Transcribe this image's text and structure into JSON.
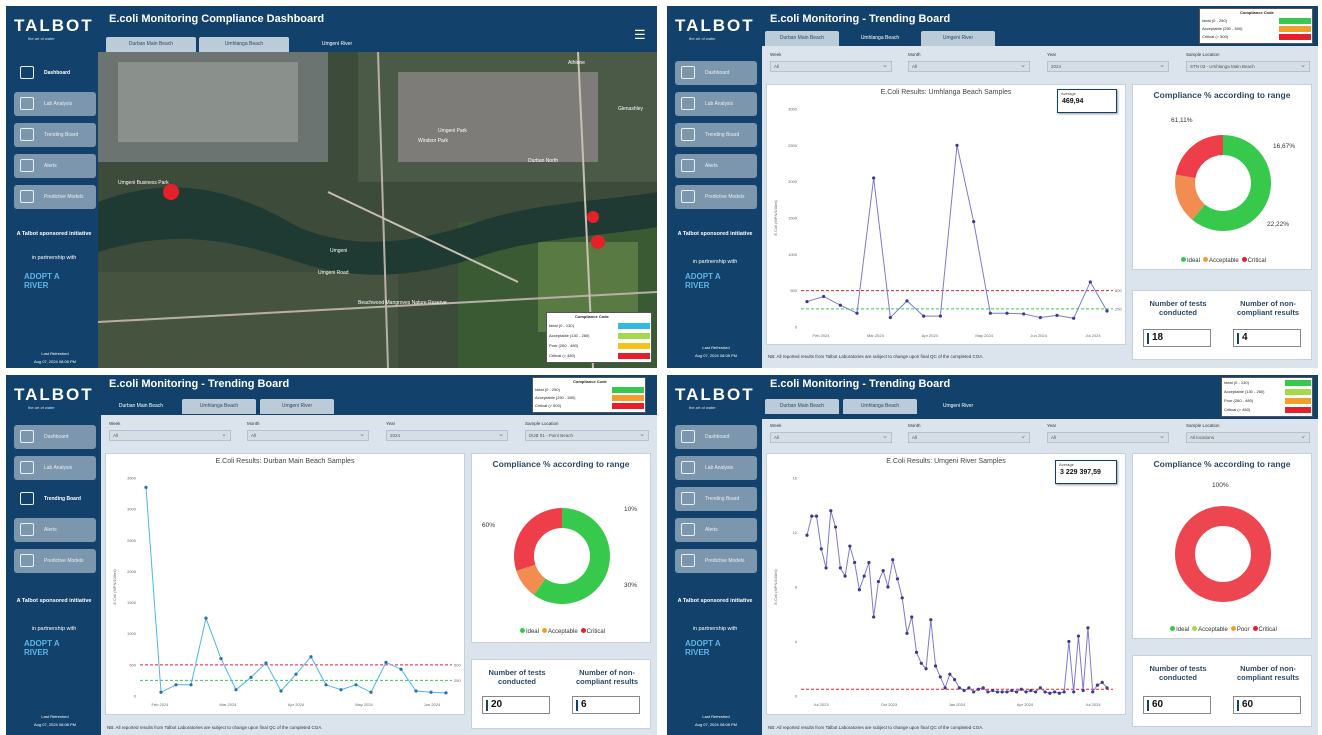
{
  "brand": {
    "logo": "TALBOT",
    "tagline": "the art of water"
  },
  "nav": {
    "dashboard": "Dashboard",
    "lab_analysis": "Lab Analysis",
    "trending_board": "Trending Board",
    "alerts": "Alerts",
    "predictive": "Predictive Models"
  },
  "sponsor": {
    "line1": "A Talbot sponsored initiative",
    "line2": "in partnership with",
    "partner": "ADOPT A RIVER"
  },
  "refresh": {
    "label": "Last Refreshed",
    "value": "Aug 07, 2024 08:08 PM"
  },
  "tabs": [
    "Durban Main Beach",
    "Umhlanga Beach",
    "Umgeni River"
  ],
  "compliance_code": {
    "title": "Compliance Code",
    "rows": [
      {
        "label": "Ideal (0 - 250)",
        "color": "#37c94b"
      },
      {
        "label": "Acceptable (250 - 500)",
        "color": "#f0a028"
      },
      {
        "label": "Critical (> 500)",
        "color": "#e5202a"
      }
    ],
    "map_rows": [
      {
        "label": "Ideal (0 - 130)",
        "color": "#32b9e6"
      },
      {
        "label": "Acceptable (130 - 260)",
        "color": "#a5d84a"
      },
      {
        "label": "Poor (260 - 480)",
        "color": "#f5c21c"
      },
      {
        "label": "Critical (> 480)",
        "color": "#e5202a"
      }
    ]
  },
  "filters": {
    "week": "Week",
    "month": "Month",
    "year": "Year",
    "location": "Sample Location",
    "all": "All",
    "year_val": "2024"
  },
  "p1": {
    "title": "E.coli Monitoring Compliance Dashboard",
    "map_labels": [
      "Umgeni Business Park",
      "Umgeni",
      "Umgeni Road",
      "Windsor Park",
      "Beachwood Mangroves Nature Reserve",
      "Athlone",
      "Durban North",
      "Umgeni Park",
      "Glenashley"
    ]
  },
  "p2": {
    "title": "E.coli Monitoring - Trending Board",
    "location": "STN 03 - Umhlanga Main Beach",
    "chart_title": "E.Coli Results: Umhlanga Beach Samples",
    "popup_label": "Average",
    "popup_value": "469,94",
    "donut_title": "Compliance % according to range",
    "pcts": [
      "61,11%",
      "16,67%",
      "22,22%"
    ],
    "kpi1_label": "Number of tests conducted",
    "kpi1": "18",
    "kpi2_label": "Number of non-compliant results",
    "kpi2": "4"
  },
  "p3": {
    "title": "E.coli Monitoring - Trending Board",
    "location": "DUB 01 - Point Beach",
    "chart_title": "E.Coli Results: Durban Main Beach Samples",
    "donut_title": "Compliance % according to range",
    "pcts": [
      "60%",
      "10%",
      "30%"
    ],
    "kpi1_label": "Number of tests conducted",
    "kpi1": "20",
    "kpi2_label": "Number of non-compliant results",
    "kpi2": "6"
  },
  "p4": {
    "title": "E.coli Monitoring - Trending Board",
    "location": "All locations",
    "chart_title": "E.Coli Results: Umgeni River Samples",
    "popup_label": "Average",
    "popup_value": "3 229 397,59",
    "donut_title": "Compliance % according to range",
    "pcts": [
      "100%"
    ],
    "kpi1_label": "Number of tests conducted",
    "kpi1": "60",
    "kpi2_label": "Number of non-compliant results",
    "kpi2": "60"
  },
  "legend_labels": {
    "ideal": "Ideal",
    "acceptable": "Acceptable",
    "poor": "Poor",
    "critical": "Critical"
  },
  "note": "NB: All reported results from Talbot Laboratories are subject to change upon final QC of the completed COA.",
  "chart_data": [
    {
      "type": "line",
      "title": "E.Coli Results: Umhlanga Beach Samples",
      "ylabel": "E.Coli (MPN/100ml)",
      "x_ticks": [
        "Feb 2024",
        "Mar 2024",
        "Apr 2024",
        "May 2024",
        "Jun 2024",
        "Jul 2024"
      ],
      "ylim": [
        0,
        3000
      ],
      "y_ticks": [
        0,
        500,
        1000,
        1500,
        2000,
        2500,
        3000
      ],
      "values": [
        350,
        420,
        300,
        190,
        2050,
        130,
        360,
        150,
        150,
        2500,
        1450,
        190,
        190,
        180,
        130,
        160,
        120,
        620,
        220
      ],
      "thresholds": [
        {
          "value": 500,
          "label": "500",
          "color": "#e5202a"
        },
        {
          "value": 250,
          "label": "250",
          "color": "#37c94b"
        }
      ]
    },
    {
      "type": "line",
      "title": "E.Coli Results: Durban Main Beach Samples",
      "ylabel": "E.Coli (MPN/100ml)",
      "x_ticks": [
        "Feb 2024",
        "Mar 2024",
        "Apr 2024",
        "May 2024",
        "Jun 2024"
      ],
      "ylim": [
        0,
        3500
      ],
      "y_ticks": [
        0,
        500,
        1000,
        1500,
        2000,
        2500,
        3000,
        3500
      ],
      "values": [
        3350,
        60,
        180,
        180,
        1250,
        600,
        100,
        300,
        530,
        80,
        350,
        630,
        180,
        100,
        180,
        60,
        540,
        430,
        80,
        60,
        50
      ],
      "thresholds": [
        {
          "value": 500,
          "label": "500",
          "color": "#e5202a"
        },
        {
          "value": 250,
          "label": "250",
          "color": "#37c94b"
        }
      ]
    },
    {
      "type": "line",
      "title": "E.Coli Results: Umgeni River Samples",
      "ylabel": "E.Coli (MPN/100ml)",
      "x_ticks": [
        "Jul 2023",
        "Oct 2023",
        "Jan 2024",
        "Apr 2024",
        "Jul 2024"
      ],
      "ylim": [
        0,
        16
      ],
      "y_ticks": [
        0,
        4,
        8,
        12,
        16
      ],
      "values": [
        11.8,
        13.2,
        13.2,
        10.8,
        9.4,
        13.6,
        12.4,
        9.4,
        8.8,
        11.0,
        9.8,
        7.8,
        8.8,
        9.8,
        5.8,
        8.4,
        9.2,
        8.0,
        10.0,
        8.6,
        7.2,
        4.6,
        5.8,
        3.2,
        2.4,
        2.0,
        5.6,
        2.2,
        1.4,
        0.6,
        1.6,
        1.2,
        0.6,
        0.4,
        0.6,
        0.3,
        0.5,
        0.6,
        0.3,
        0.4,
        0.3,
        0.3,
        0.3,
        0.4,
        0.3,
        0.5,
        0.3,
        0.4,
        0.3,
        0.6,
        0.3,
        0.2,
        0.3,
        0.2,
        0.3,
        4.0,
        0.3,
        4.4,
        0.4,
        5.0,
        0.3,
        0.8,
        1.0,
        0.6
      ],
      "thresholds": [
        {
          "value": 0.5,
          "label": "",
          "color": "#e5202a"
        }
      ]
    }
  ]
}
